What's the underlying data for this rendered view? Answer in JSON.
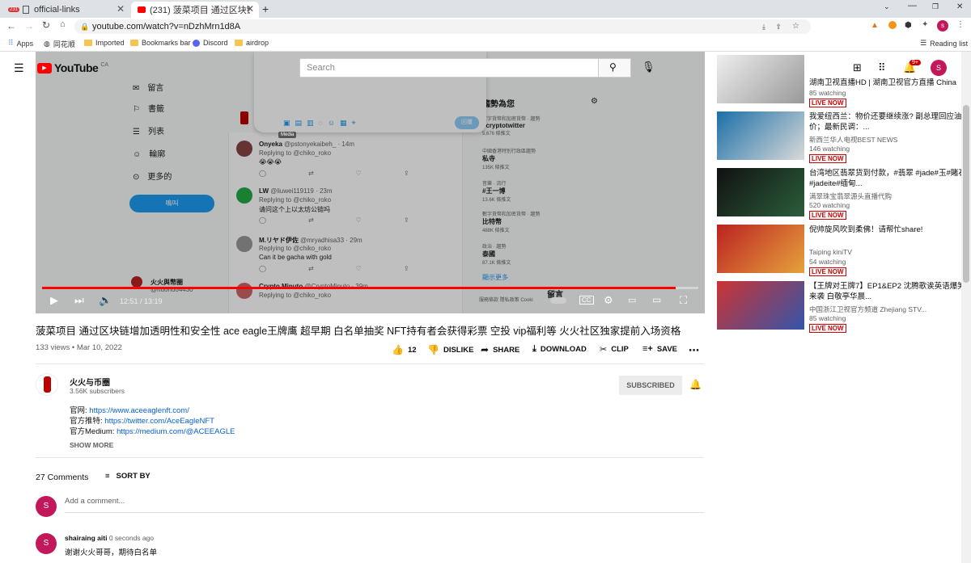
{
  "browser": {
    "tabs": [
      {
        "label": "official-links"
      },
      {
        "label": "(231) 菠菜项目 通过区块链增加透明"
      }
    ],
    "tab_badge": "231",
    "url": "youtube.com/watch?v=nDzhMrn1d8A",
    "bookmarks": [
      "Apps",
      "同花顺",
      "Imported",
      "Bookmarks bar",
      "Discord",
      "airdrop"
    ],
    "reading_list": "Reading list",
    "profile_initial": "s"
  },
  "youtube": {
    "logo": "YouTube",
    "region": "CA",
    "search_placeholder": "Search",
    "notif_count": "9+",
    "avatar_initial": "S"
  },
  "video_content": {
    "sidebar_items": [
      "留言",
      "書籤",
      "列表",
      "輪廓",
      "更多的"
    ],
    "tweet_button": "鳴叫",
    "reply_button": "回覆",
    "tooltip": "Media",
    "trends_title": "趨勢為您",
    "trends": [
      {
        "cat": "數字貨幣和加密貨幣 · 趨勢",
        "name": "#cryptotwitter",
        "count": "5,676 條推文"
      },
      {
        "cat": "中國香港特別行政區趨勢",
        "name": "私寺",
        "count": "135K 條推文"
      },
      {
        "cat": "音樂 · 流行",
        "name": "#王一博",
        "count": "13.6K 條推文"
      },
      {
        "cat": "數字貨幣和加密貨幣 · 趨勢",
        "name": "比特幣",
        "count": "488K 條推文"
      },
      {
        "cat": "政治 · 趨勢",
        "name": "泰國",
        "count": "87.1K 條推文"
      }
    ],
    "show_more": "顯示更多",
    "footer_links": "服務條款  隱私政策  Cooki",
    "tweets": [
      {
        "name": "Onyeka",
        "handle": "@pstonyekaibeh_ · 14m",
        "reply": "Replying to @chiko_roko",
        "text": "😭😭😭"
      },
      {
        "name": "LW",
        "handle": "@liuwei119119 · 23m",
        "reply": "Replying to @chiko_roko",
        "text": "请问这个上以太坊公链吗"
      },
      {
        "name": "M.リヤド伊佐",
        "handle": "@mryadhisa33 · 29m",
        "reply": "Replying to @chiko_roko",
        "text": "Can it be gacha with gold"
      },
      {
        "name": "Crypto Minuto",
        "handle": "@CryptoMinuto · 39m",
        "reply": "Replying to @chiko_roko",
        "text": ""
      }
    ],
    "profile_name": "火火與幣圈",
    "profile_handle": "@huohuo4430",
    "messages_label": "留言"
  },
  "player": {
    "time": "12:51 / 13:19",
    "progress": 0.965
  },
  "video": {
    "title": "菠菜项目 通过区块链增加透明性和安全性 ace eagle王牌鹰 超早期 白名单抽奖 NFT持有者会获得彩票 空投 vip福利等 火火社区独家提前入场资格",
    "meta": "133 views • Mar 10, 2022",
    "likes": "12",
    "dislike": "DISLIKE",
    "share": "SHARE",
    "download": "DOWNLOAD",
    "clip": "CLIP",
    "save": "SAVE"
  },
  "channel": {
    "name": "火火与币圈",
    "subs": "3.56K subscribers",
    "subscribed": "SUBSCRIBED",
    "desc": [
      {
        "label": "官网: ",
        "link": "https://www.aceeaglenft.com/"
      },
      {
        "label": "官方推特: ",
        "link": "https://twitter.com/AceEagleNFT"
      },
      {
        "label": "官方Medium: ",
        "link": "https://medium.com/@ACEEAGLE"
      }
    ],
    "show_more": "SHOW MORE"
  },
  "comments": {
    "count": "27 Comments",
    "sort": "SORT BY",
    "add_placeholder": "Add a comment...",
    "avatar": "S",
    "items": [
      {
        "author": "shairaing aiti",
        "time": "0 seconds ago",
        "text": "谢谢火火哥哥，期待白名单"
      }
    ]
  },
  "recommended": [
    {
      "title": "湖南卫视直播HD | 湖南卫视官方直播 China Hun...",
      "channel": "",
      "watching": "85 watching",
      "live": "LIVE NOW"
    },
    {
      "title": "我爱纽西兰：物价还要继续涨? 副总理回应油价；最新民调：...",
      "channel": "新西兰华人电视BEST NEWS",
      "watching": "146 watching",
      "live": "LIVE NOW"
    },
    {
      "title": "台湾地区翡翠货到付款，#翡翠 #jade#玉#賭石#jadeite#缅甸...",
      "channel": "满翠珠宝翡翠源头直播代购",
      "watching": "520 watching",
      "live": "LIVE NOW"
    },
    {
      "title": "倪帅旋风吹到柔佛！请帮忙share!",
      "channel": "Taiping kiniTV",
      "watching": "54 watching",
      "live": "LIVE NOW"
    },
    {
      "title": "【王牌对王牌7】EP1&EP2 沈腾歌诶英语爆笑来袭 白敬亭华晨...",
      "channel": "中国浙江卫视官方频道 Zhejiang STV...",
      "watching": "85 watching",
      "live": "LIVE NOW"
    }
  ]
}
